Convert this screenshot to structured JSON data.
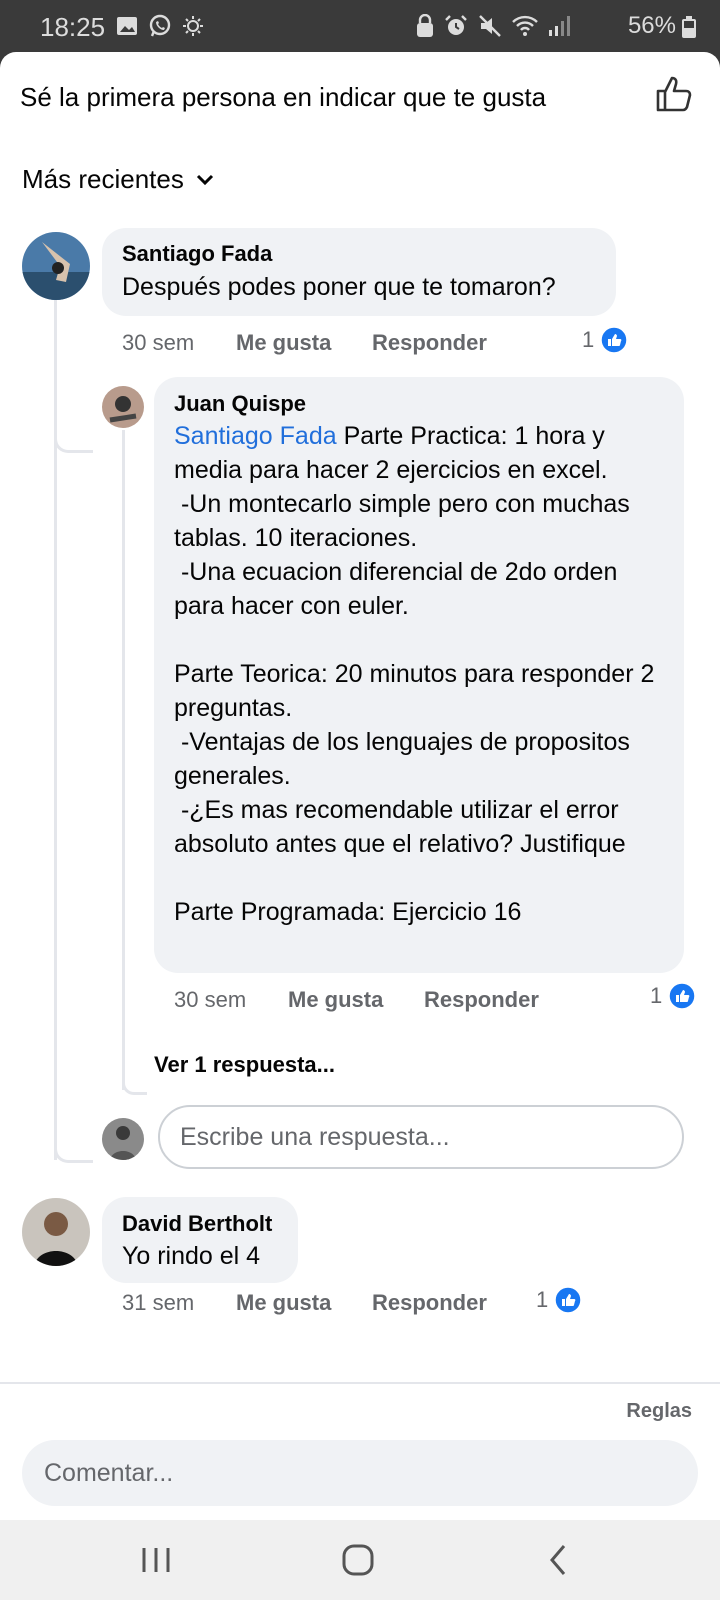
{
  "status_bar": {
    "time": "18:25",
    "battery": "56%",
    "icons_left": [
      "gallery-icon",
      "whatsapp-icon",
      "brightness-icon"
    ],
    "icons_right": [
      "lock-icon",
      "alarm-icon",
      "mute-icon",
      "wifi-icon",
      "signal-icon",
      "battery-icon"
    ]
  },
  "header": {
    "likes_prompt": "Sé la primera persona en indicar que te gusta",
    "sort_label": "Más recientes"
  },
  "comments": [
    {
      "author": "Santiago Fada",
      "text": "Después podes poner que te tomaron?",
      "time": "30 sem",
      "like_label": "Me gusta",
      "reply_label": "Responder",
      "reactions": "1"
    },
    {
      "author": "David Bertholt",
      "text": "Yo rindo el 4",
      "time": "31 sem",
      "like_label": "Me gusta",
      "reply_label": "Responder",
      "reactions": "1"
    }
  ],
  "reply": {
    "author": "Juan Quispe",
    "mention": "Santiago Fada",
    "text": " Parte Practica: 1 hora y media para hacer 2 ejercicios en excel.\n -Un montecarlo simple pero con muchas tablas. 10 iteraciones.\n -Una ecuacion diferencial de 2do orden para hacer con euler.\n\nParte Teorica: 20 minutos para responder 2 preguntas.\n -Ventajas de los lenguajes de propositos generales.\n -¿Es mas recomendable utilizar el error absoluto antes que el relativo? Justifique\n\nParte Programada: Ejercicio 16",
    "time": "30 sem",
    "like_label": "Me gusta",
    "reply_label": "Responder",
    "reactions": "1",
    "view_more": "Ver 1 respuesta..."
  },
  "reply_input": {
    "placeholder": "Escribe una respuesta..."
  },
  "footer": {
    "rules": "Reglas",
    "comment_placeholder": "Comentar..."
  },
  "colors": {
    "accent": "#1877f2",
    "mention": "#216fdb",
    "bubble": "#f0f2f5",
    "muted": "#65676b"
  }
}
